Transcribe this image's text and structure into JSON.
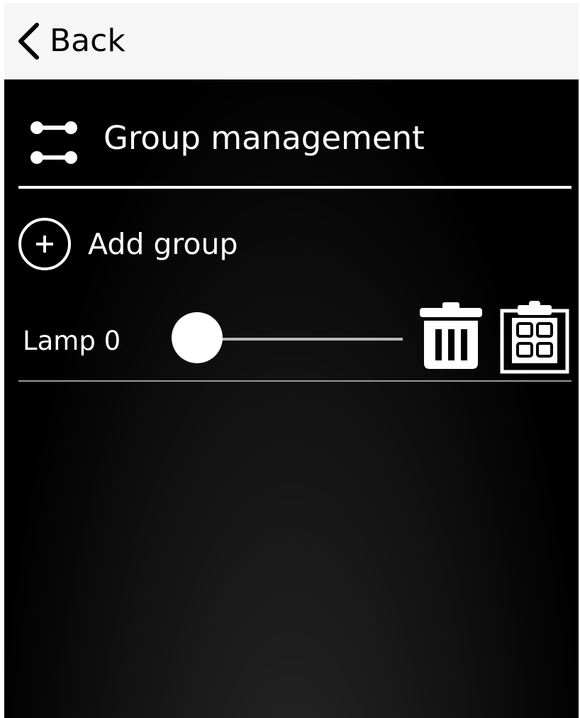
{
  "topbar": {
    "back_label": "Back",
    "back_icon": "chevron-left-icon"
  },
  "header": {
    "title": "Group management",
    "icon": "group-link-icon"
  },
  "add_group": {
    "label": "Add group",
    "icon": "plus-circle-icon"
  },
  "groups": [
    {
      "label": "Lamp 0",
      "slider_value": 0,
      "delete_icon": "trash-icon",
      "assign_icon": "clipboard-grid-icon"
    }
  ],
  "colors": {
    "topbar_bg": "#f6f6f6",
    "content_bg": "#000000",
    "text_dark": "#000000",
    "text_light": "#ffffff",
    "track": "#b8b8b8"
  }
}
